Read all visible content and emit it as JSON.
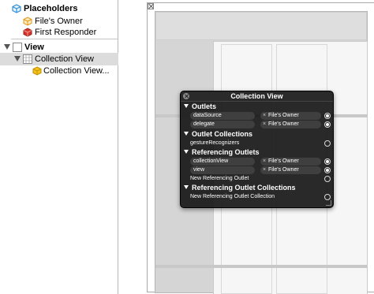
{
  "outline": {
    "placeholders_label": "Placeholders",
    "files_owner_label": "File's Owner",
    "first_responder_label": "First Responder",
    "view_label": "View",
    "collection_view_label": "Collection View",
    "collection_view_cell_label": "Collection View..."
  },
  "icons": {
    "placeholders": "cube-icon",
    "files_owner": "files-owner-cube-icon",
    "first_responder": "first-responder-cube-icon",
    "view": "view-icon",
    "collection_view": "collection-view-icon",
    "cell": "cell-cube-icon"
  },
  "hud": {
    "title": "Collection View",
    "sections": {
      "outlets": "Outlets",
      "outlet_collections": "Outlet Collections",
      "referencing_outlets": "Referencing Outlets",
      "referencing_outlet_collections": "Referencing Outlet Collections"
    },
    "outlets": [
      {
        "name": "dataSource",
        "target": "File's Owner",
        "connected": true
      },
      {
        "name": "delegate",
        "target": "File's Owner",
        "connected": true
      }
    ],
    "outlet_collections": [
      {
        "name": "gestureRecognizers",
        "connected": false
      }
    ],
    "referencing_outlets": [
      {
        "name": "collectionView",
        "target": "File's Owner",
        "connected": true
      },
      {
        "name": "view",
        "target": "File's Owner",
        "connected": true
      },
      {
        "name": "New Referencing Outlet",
        "connected": false
      }
    ],
    "referencing_outlet_collections": [
      {
        "name": "New Referencing Outlet Collection",
        "connected": false
      }
    ],
    "remove_glyph": "×"
  },
  "colors": {
    "selection": "#dcdcdc",
    "hud_background": "#191919",
    "cube_blue": "#2f8fd8",
    "cube_orange": "#f0a020",
    "cube_red": "#d9342b",
    "cube_yellow": "#f2c21b"
  }
}
